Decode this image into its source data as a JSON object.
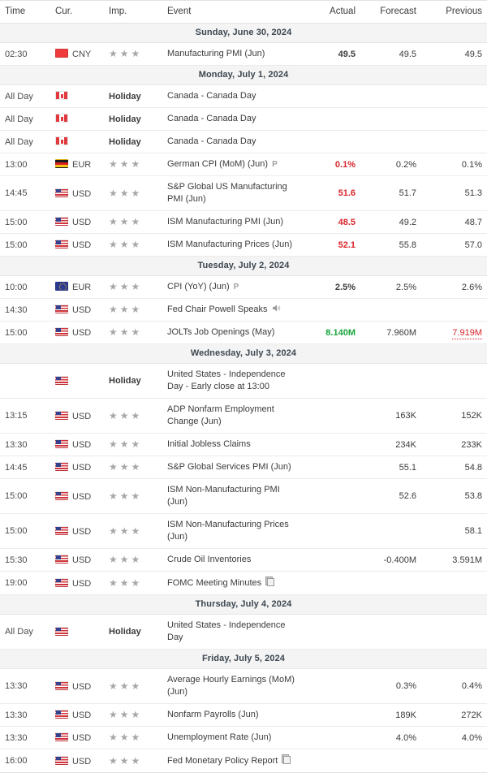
{
  "table": {
    "columns": [
      "Time",
      "Cur.",
      "Imp.",
      "Event",
      "Actual",
      "Forecast",
      "Previous"
    ],
    "sections": [
      {
        "date_label": "Sunday, June 30, 2024",
        "rows": [
          {
            "time": "02:30",
            "currency": "CNY",
            "flag": "cny-flag",
            "importance": 3,
            "event": "Manufacturing PMI (Jun)",
            "icon": "",
            "actual": "49.5",
            "actual_state": "black",
            "forecast": "49.5",
            "previous": "49.5",
            "previous_state": "black"
          }
        ]
      },
      {
        "date_label": "Monday, July 1, 2024",
        "rows": [
          {
            "time": "All Day",
            "currency": "",
            "flag": "canada-flag",
            "importance": 0,
            "holiday": "Holiday",
            "event": "Canada - Canada Day",
            "icon": "",
            "actual": "",
            "actual_state": "black",
            "forecast": "",
            "previous": "",
            "previous_state": "black"
          },
          {
            "time": "All Day",
            "currency": "",
            "flag": "canada-flag",
            "importance": 0,
            "holiday": "Holiday",
            "event": "Canada - Canada Day",
            "icon": "",
            "actual": "",
            "actual_state": "black",
            "forecast": "",
            "previous": "",
            "previous_state": "black"
          },
          {
            "time": "All Day",
            "currency": "",
            "flag": "canada-flag",
            "importance": 0,
            "holiday": "Holiday",
            "event": "Canada - Canada Day",
            "icon": "",
            "actual": "",
            "actual_state": "black",
            "forecast": "",
            "previous": "",
            "previous_state": "black"
          },
          {
            "time": "13:00",
            "currency": "EUR",
            "flag": "germany-flag",
            "importance": 3,
            "event": "German CPI (MoM) (Jun)",
            "icon": "preliminary-icon",
            "actual": "0.1%",
            "actual_state": "red",
            "forecast": "0.2%",
            "previous": "0.1%",
            "previous_state": "black"
          },
          {
            "time": "14:45",
            "currency": "USD",
            "flag": "usa-flag",
            "importance": 3,
            "event": "S&P Global US Manufacturing PMI (Jun)",
            "icon": "",
            "actual": "51.6",
            "actual_state": "red",
            "forecast": "51.7",
            "previous": "51.3",
            "previous_state": "black"
          },
          {
            "time": "15:00",
            "currency": "USD",
            "flag": "usa-flag",
            "importance": 3,
            "event": "ISM Manufacturing PMI (Jun)",
            "icon": "",
            "actual": "48.5",
            "actual_state": "red",
            "forecast": "49.2",
            "previous": "48.7",
            "previous_state": "black"
          },
          {
            "time": "15:00",
            "currency": "USD",
            "flag": "usa-flag",
            "importance": 3,
            "event": "ISM Manufacturing Prices (Jun)",
            "icon": "",
            "actual": "52.1",
            "actual_state": "red",
            "forecast": "55.8",
            "previous": "57.0",
            "previous_state": "black"
          }
        ]
      },
      {
        "date_label": "Tuesday, July 2, 2024",
        "rows": [
          {
            "time": "10:00",
            "currency": "EUR",
            "flag": "eu-flag",
            "importance": 3,
            "event": "CPI (YoY) (Jun)",
            "icon": "preliminary-icon",
            "actual": "2.5%",
            "actual_state": "black",
            "forecast": "2.5%",
            "previous": "2.6%",
            "previous_state": "black"
          },
          {
            "time": "14:30",
            "currency": "USD",
            "flag": "usa-flag",
            "importance": 3,
            "event": "Fed Chair Powell Speaks",
            "icon": "speaker-icon",
            "actual": "",
            "actual_state": "black",
            "forecast": "",
            "previous": "",
            "previous_state": "black"
          },
          {
            "time": "15:00",
            "currency": "USD",
            "flag": "usa-flag",
            "importance": 3,
            "event": "JOLTs Job Openings (May)",
            "icon": "",
            "actual": "8.140M",
            "actual_state": "green",
            "forecast": "7.960M",
            "previous": "7.919M",
            "previous_state": "revised"
          }
        ]
      },
      {
        "date_label": "Wednesday, July 3, 2024",
        "rows": [
          {
            "time": "",
            "currency": "",
            "flag": "usa-flag",
            "importance": 0,
            "holiday": "Holiday",
            "event": "United States - Independence Day - Early close at 13:00",
            "icon": "",
            "actual": "",
            "actual_state": "black",
            "forecast": "",
            "previous": "",
            "previous_state": "black"
          },
          {
            "time": "13:15",
            "currency": "USD",
            "flag": "usa-flag",
            "importance": 3,
            "event": "ADP Nonfarm Employment Change (Jun)",
            "icon": "",
            "actual": "",
            "actual_state": "black",
            "forecast": "163K",
            "previous": "152K",
            "previous_state": "black"
          },
          {
            "time": "13:30",
            "currency": "USD",
            "flag": "usa-flag",
            "importance": 3,
            "event": "Initial Jobless Claims",
            "icon": "",
            "actual": "",
            "actual_state": "black",
            "forecast": "234K",
            "previous": "233K",
            "previous_state": "black"
          },
          {
            "time": "14:45",
            "currency": "USD",
            "flag": "usa-flag",
            "importance": 3,
            "event": "S&P Global Services PMI (Jun)",
            "icon": "",
            "actual": "",
            "actual_state": "black",
            "forecast": "55.1",
            "previous": "54.8",
            "previous_state": "black"
          },
          {
            "time": "15:00",
            "currency": "USD",
            "flag": "usa-flag",
            "importance": 3,
            "event": "ISM Non-Manufacturing PMI (Jun)",
            "icon": "",
            "actual": "",
            "actual_state": "black",
            "forecast": "52.6",
            "previous": "53.8",
            "previous_state": "black"
          },
          {
            "time": "15:00",
            "currency": "USD",
            "flag": "usa-flag",
            "importance": 3,
            "event": "ISM Non-Manufacturing Prices (Jun)",
            "icon": "",
            "actual": "",
            "actual_state": "black",
            "forecast": "",
            "previous": "58.1",
            "previous_state": "black"
          },
          {
            "time": "15:30",
            "currency": "USD",
            "flag": "usa-flag",
            "importance": 3,
            "event": "Crude Oil Inventories",
            "icon": "",
            "actual": "",
            "actual_state": "black",
            "forecast": "-0.400M",
            "previous": "3.591M",
            "previous_state": "black"
          },
          {
            "time": "19:00",
            "currency": "USD",
            "flag": "usa-flag",
            "importance": 3,
            "event": "FOMC Meeting Minutes",
            "icon": "document-icon",
            "actual": "",
            "actual_state": "black",
            "forecast": "",
            "previous": "",
            "previous_state": "black"
          }
        ]
      },
      {
        "date_label": "Thursday, July 4, 2024",
        "rows": [
          {
            "time": "All Day",
            "currency": "",
            "flag": "usa-flag",
            "importance": 0,
            "holiday": "Holiday",
            "event": "United States - Independence Day",
            "icon": "",
            "actual": "",
            "actual_state": "black",
            "forecast": "",
            "previous": "",
            "previous_state": "black"
          }
        ]
      },
      {
        "date_label": "Friday, July 5, 2024",
        "rows": [
          {
            "time": "13:30",
            "currency": "USD",
            "flag": "usa-flag",
            "importance": 3,
            "event": "Average Hourly Earnings (MoM) (Jun)",
            "icon": "",
            "actual": "",
            "actual_state": "black",
            "forecast": "0.3%",
            "previous": "0.4%",
            "previous_state": "black"
          },
          {
            "time": "13:30",
            "currency": "USD",
            "flag": "usa-flag",
            "importance": 3,
            "event": "Nonfarm Payrolls (Jun)",
            "icon": "",
            "actual": "",
            "actual_state": "black",
            "forecast": "189K",
            "previous": "272K",
            "previous_state": "black"
          },
          {
            "time": "13:30",
            "currency": "USD",
            "flag": "usa-flag",
            "importance": 3,
            "event": "Unemployment Rate (Jun)",
            "icon": "",
            "actual": "",
            "actual_state": "black",
            "forecast": "4.0%",
            "previous": "4.0%",
            "previous_state": "black"
          },
          {
            "time": "16:00",
            "currency": "USD",
            "flag": "usa-flag",
            "importance": 3,
            "event": "Fed Monetary Policy Report",
            "icon": "document-icon",
            "actual": "",
            "actual_state": "black",
            "forecast": "",
            "previous": "",
            "previous_state": "black"
          }
        ]
      }
    ]
  },
  "icons": {
    "preliminary_label": "P",
    "star_glyph": "★"
  },
  "colors": {
    "worse_than_forecast": "#d9242a",
    "better_than_forecast": "#18a53c",
    "neutral": "#3b3b3b",
    "star": "#a7a7a7",
    "day_header_bg": "#f4f4f4"
  }
}
